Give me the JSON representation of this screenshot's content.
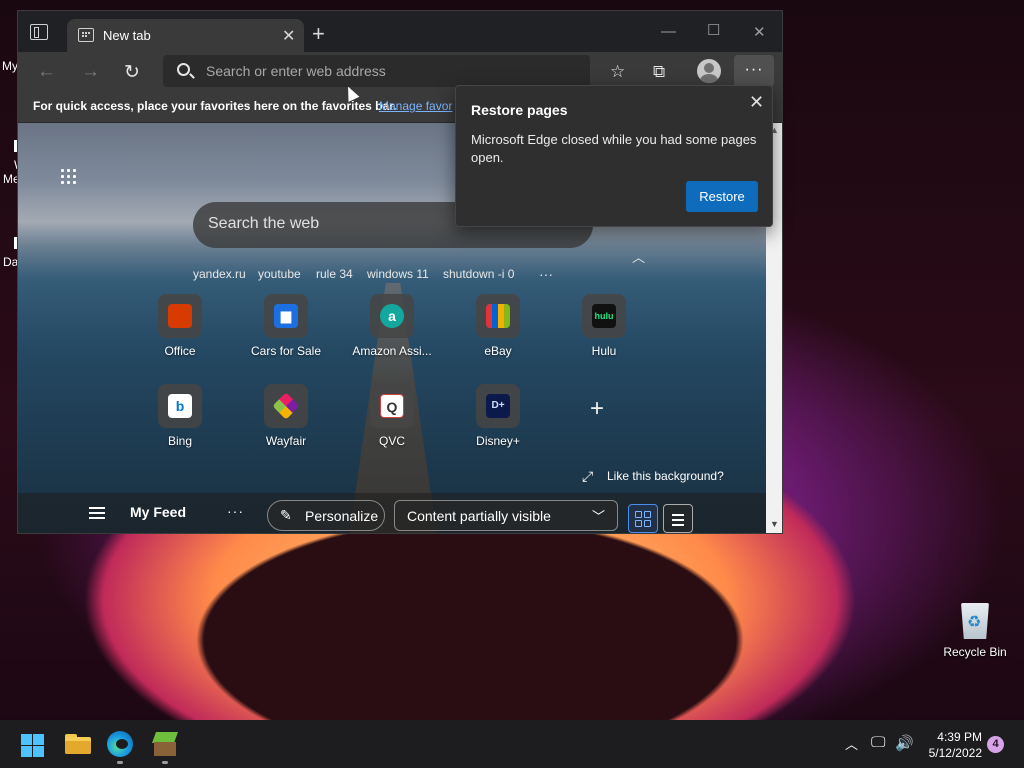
{
  "desktop": {
    "peek_labels": [
      "My",
      "W",
      "Me",
      "Da"
    ],
    "recycle_bin_label": "Recycle Bin"
  },
  "browser": {
    "tab": {
      "title": "New tab",
      "close": "✕"
    },
    "new_tab_glyph": "+",
    "window_controls": {
      "minimize": "—",
      "maximize": "☐",
      "close": "✕"
    },
    "address_bar": {
      "placeholder": "Search or enter web address"
    },
    "toolbar_icons": [
      "back-arrow-icon",
      "forward-arrow-icon",
      "refresh-icon",
      "favorites-icon",
      "collections-icon",
      "profile-icon",
      "more-icon"
    ],
    "favorites_bar": {
      "message": "For quick access, place your favorites here on the favorites bar.",
      "link": "Manage favor"
    }
  },
  "newtab": {
    "search": {
      "placeholder": "Search the web"
    },
    "quick_links": [
      "yandex.ru",
      "youtube",
      "rule 34",
      "windows 11",
      "shutdown -i 0"
    ],
    "quick_links_more": "···",
    "tiles": [
      {
        "label": "Office",
        "logo": "O",
        "color": "#d83b01"
      },
      {
        "label": "Cars for Sale",
        "logo": "🚗",
        "color": "#1b6fe0"
      },
      {
        "label": "Amazon Assi...",
        "logo": "a",
        "color": "#13a89e"
      },
      {
        "label": "eBay",
        "logo": "🛍",
        "color": "#e53238"
      },
      {
        "label": "Hulu",
        "logo": "hulu",
        "color": "#111111"
      },
      {
        "label": "Bing",
        "logo": "b",
        "color": "#ffffff"
      },
      {
        "label": "Wayfair",
        "logo": "✦",
        "color": "#7b1fa2"
      },
      {
        "label": "QVC",
        "logo": "Q",
        "color": "#ffffff"
      },
      {
        "label": "Disney+",
        "logo": "D+",
        "color": "#0b1a4a"
      }
    ],
    "add_tile": "+",
    "like_background": "Like this background?",
    "feed": {
      "label": "My Feed",
      "more": "···",
      "personalize": "Personalize",
      "visibility": "Content partially visible"
    }
  },
  "restore_popup": {
    "title": "Restore pages",
    "body": "Microsoft Edge closed while you had some pages open.",
    "button": "Restore",
    "close": "✕"
  },
  "taskbar": {
    "time": "4:39 PM",
    "date": "5/12/2022",
    "notification_count": "4",
    "accent": "#4cc2ff"
  }
}
